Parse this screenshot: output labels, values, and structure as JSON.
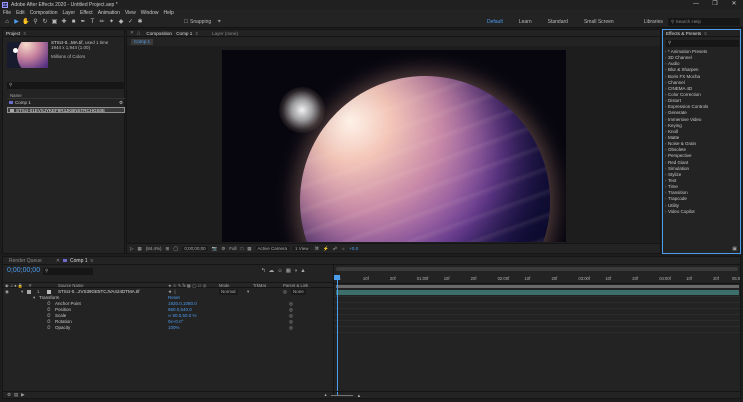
{
  "window": {
    "title": "Adobe After Effects 2020 - Untitled Project.aep *",
    "app_badge": "Ae"
  },
  "menu": [
    "File",
    "Edit",
    "Composition",
    "Layer",
    "Effect",
    "Animation",
    "View",
    "Window",
    "Help"
  ],
  "toolbar": {
    "snapping_label": "Snapping",
    "workspaces": [
      {
        "label": "Default",
        "active": true
      },
      {
        "label": "Learn",
        "active": false
      },
      {
        "label": "Standard",
        "active": false
      },
      {
        "label": "Small Screen",
        "active": false
      },
      {
        "label": "Libraries",
        "active": false
      }
    ],
    "more": "»",
    "search_placeholder": "Search Help"
  },
  "project": {
    "tab": "Project",
    "item_name": "STScI-0...MA.tif",
    "used_text": ", used 1 time",
    "dimensions": "1944 x 1,944 (1.00)",
    "color_info": "Millions of Colors",
    "column_name": "Name",
    "items": [
      {
        "name": "Comp 1",
        "type": "comp",
        "selected": false
      },
      {
        "name": "STScI-01EVSJYKEF9R3JKBNSTRCHGS0E",
        "type": "footage",
        "selected": true
      }
    ],
    "footer_bpc": "8 bpc"
  },
  "composition": {
    "tab": "Composition",
    "tab_comp": "Comp 1",
    "layer_tab": "Layer (none)",
    "sub_tab": "Comp 1",
    "controls": {
      "zoom": "(84.4%)",
      "timecode": "0;00;00;00",
      "resolution": "Full",
      "camera": "Active Camera",
      "views": "1 View",
      "exposure": "+0.0"
    }
  },
  "effects": {
    "tab": "Effects & Presets",
    "categories": [
      "* Animation Presets",
      "3D Channel",
      "Audio",
      "Blur & Sharpen",
      "Boris FX Mocha",
      "Channel",
      "CINEMA 4D",
      "Color Correction",
      "Distort",
      "Expression Controls",
      "Generate",
      "Immersive Video",
      "Keying",
      "Knoll",
      "Matte",
      "Noise & Grain",
      "Obsolete",
      "Perspective",
      "Red Giant",
      "Simulation",
      "Stylize",
      "Text",
      "Time",
      "Transition",
      "Trapcode",
      "Utility",
      "Video Copilot"
    ]
  },
  "timeline": {
    "render_queue_tab": "Render Queue",
    "comp_tab": "Comp 1",
    "timecode": "0;00;00;00",
    "columns": {
      "source_name": "Source Name",
      "mode": "Mode",
      "trkmat": "TrkMat",
      "parent": "Parent & Link"
    },
    "layer": {
      "number": "1",
      "name": "STScI-0...2VS39GE5TCJVA424DTMA.tif",
      "mode": "Normal",
      "parent": "None"
    },
    "transform_label": "Transform",
    "reset_label": "Reset",
    "properties": [
      {
        "name": "Anchor Point",
        "value": "1920.0,1080.0"
      },
      {
        "name": "Position",
        "value": "960.0,540.0"
      },
      {
        "name": "Scale",
        "value": "∞ 50.0,50.0 %"
      },
      {
        "name": "Rotation",
        "value": "0x+0.0°"
      },
      {
        "name": "Opacity",
        "value": "100%"
      }
    ],
    "ruler_ticks": [
      "0s",
      "10f",
      "20f",
      "01:00f",
      "10f",
      "20f",
      "02:00f",
      "10f",
      "20f",
      "03:00f",
      "10f",
      "20f",
      "04:00f",
      "10f",
      "20f",
      "05:0"
    ]
  }
}
